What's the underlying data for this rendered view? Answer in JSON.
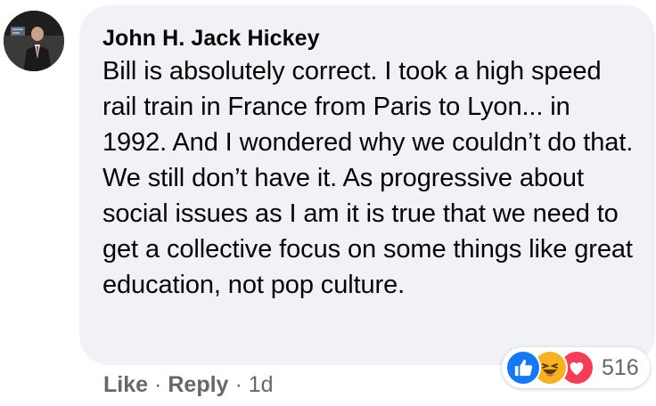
{
  "comment": {
    "author": "John H. Jack Hickey",
    "text": "Bill is absolutely correct. I took a high speed rail train in France from Paris to Lyon... in 1992. And I wondered why we couldn’t do that. We still don’t have it. As progressive about social issues as I am it is true that we need to get a collective focus on some things like great education, not pop culture."
  },
  "reactions": {
    "icons": [
      "like-icon",
      "haha-icon",
      "love-icon"
    ],
    "count": "516",
    "colors": {
      "like": "#1877f2",
      "haha": "#f7b125",
      "love": "#f33e58"
    }
  },
  "actions": {
    "like_label": "Like",
    "separator": "·",
    "reply_label": "Reply",
    "timestamp": "1d"
  },
  "colors": {
    "bubble_bg": "#f0f2f5",
    "text": "#050505",
    "secondary_text": "#65676b"
  }
}
